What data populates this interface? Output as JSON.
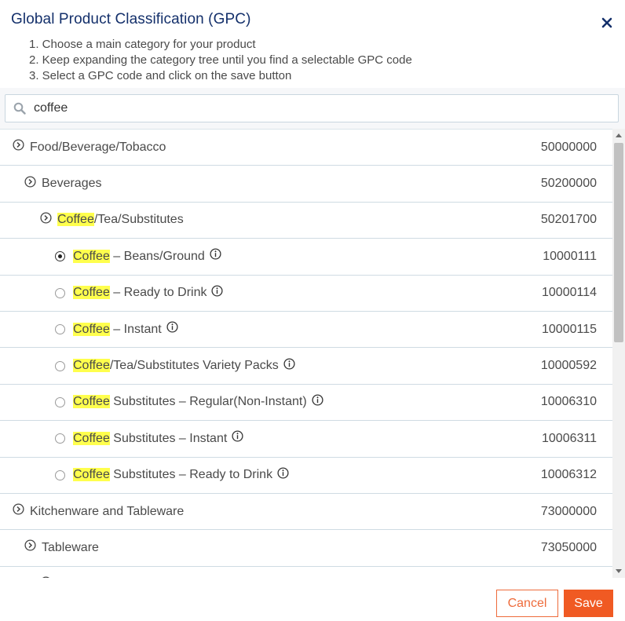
{
  "dialog": {
    "title": "Global Product Classification (GPC)",
    "instructions": [
      "1. Choose a main category for your product",
      "2. Keep expanding the category tree until you find a selectable GPC code",
      "3. Select a GPC code and click on the save button"
    ]
  },
  "search": {
    "value": "coffee",
    "icon": "search-icon"
  },
  "tree": {
    "rows": [
      {
        "type": "category",
        "level": 0,
        "pre": "",
        "hl": "",
        "post": "Food/Beverage/Tobacco",
        "code": "50000000"
      },
      {
        "type": "category",
        "level": 1,
        "pre": "",
        "hl": "",
        "post": "Beverages",
        "code": "50200000"
      },
      {
        "type": "category",
        "level": 2,
        "pre": "",
        "hl": "Coffee",
        "post": "/Tea/Substitutes",
        "code": "50201700"
      },
      {
        "type": "option",
        "checked": true,
        "hl": "Coffee",
        "post": " – Beans/Ground",
        "code": "10000111"
      },
      {
        "type": "option",
        "checked": false,
        "hl": "Coffee",
        "post": " – Ready to Drink",
        "code": "10000114"
      },
      {
        "type": "option",
        "checked": false,
        "hl": "Coffee",
        "post": " – Instant",
        "code": "10000115"
      },
      {
        "type": "option",
        "checked": false,
        "hl": "Coffee",
        "post": "/Tea/Substitutes Variety Packs",
        "code": "10000592"
      },
      {
        "type": "option",
        "checked": false,
        "hl": "Coffee",
        "post": " Substitutes – Regular(Non-Instant)",
        "code": "10006310"
      },
      {
        "type": "option",
        "checked": false,
        "hl": "Coffee",
        "post": " Substitutes – Instant",
        "code": "10006311"
      },
      {
        "type": "option",
        "checked": false,
        "hl": "Coffee",
        "post": " Substitutes – Ready to Drink",
        "code": "10006312"
      },
      {
        "type": "category",
        "level": 0,
        "pre": "",
        "hl": "",
        "post": "Kitchenware and Tableware",
        "code": "73000000"
      },
      {
        "type": "category",
        "level": 1,
        "pre": "",
        "hl": "",
        "post": "Tableware",
        "code": "73050000"
      }
    ]
  },
  "footer": {
    "cancel_label": "Cancel",
    "save_label": "Save"
  },
  "colors": {
    "title": "#14306b",
    "highlight": "#ffff4d",
    "accent": "#f05a23"
  }
}
